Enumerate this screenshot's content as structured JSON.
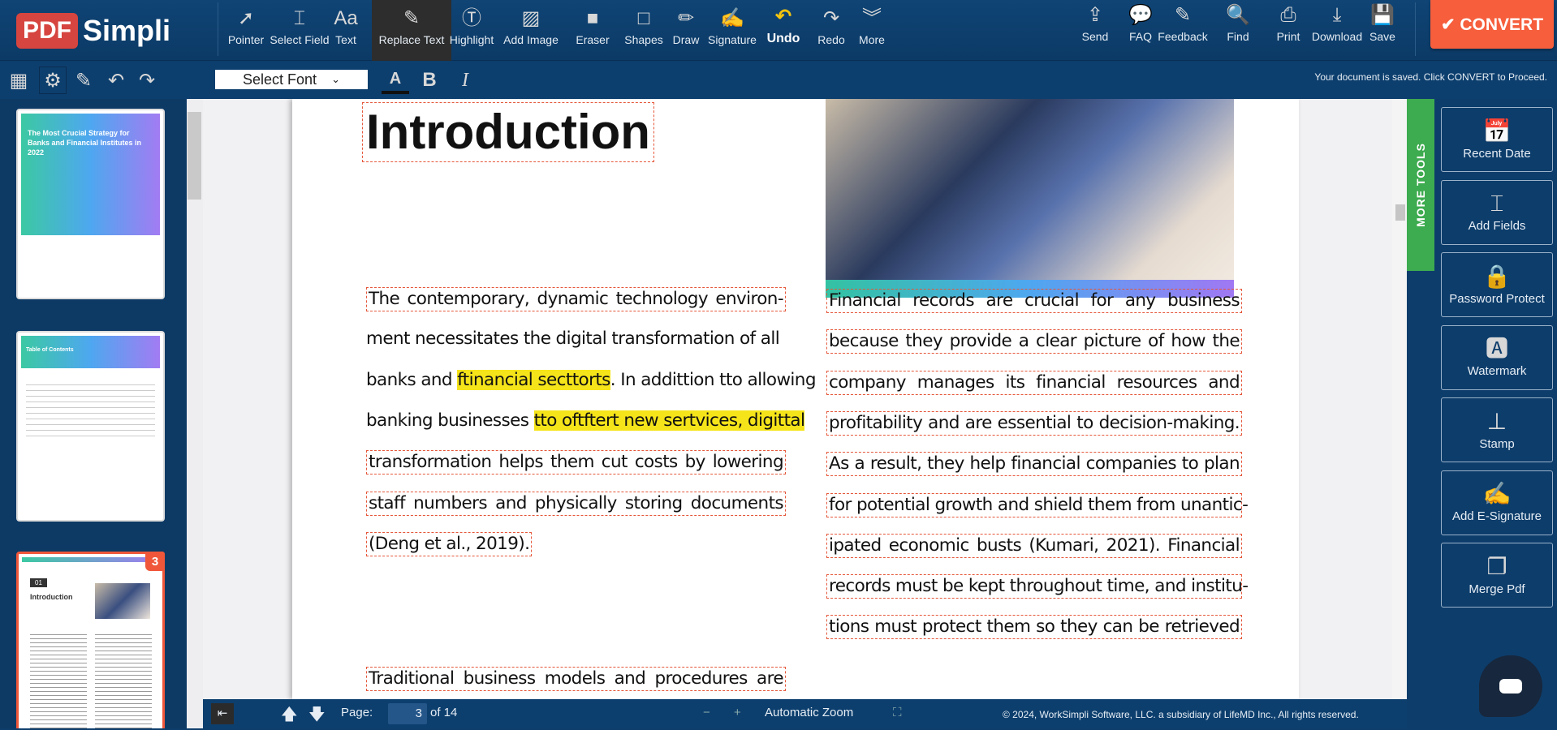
{
  "logo": {
    "pdf": "PDF",
    "simpli": "Simpli"
  },
  "toolbar": {
    "left": [
      {
        "label": "Pointer",
        "icon": "➚"
      },
      {
        "label": "Select Field",
        "icon": "⌶"
      },
      {
        "label": "Text",
        "icon": "Aa"
      },
      {
        "label": "Replace Text",
        "icon": "✎"
      },
      {
        "label": "Highlight",
        "icon": "Ⓣ"
      },
      {
        "label": "Add Image",
        "icon": "▨"
      },
      {
        "label": "Eraser",
        "icon": "■"
      },
      {
        "label": "Shapes",
        "icon": "□"
      },
      {
        "label": "Draw",
        "icon": "✏"
      },
      {
        "label": "Signature",
        "icon": "✍"
      },
      {
        "label": "Undo",
        "icon": "↶"
      },
      {
        "label": "Redo",
        "icon": "↷"
      },
      {
        "label": "More",
        "icon": "︾"
      }
    ],
    "right": [
      {
        "label": "Send",
        "icon": "⇪"
      },
      {
        "label": "FAQ",
        "icon": "💬"
      },
      {
        "label": "Feedback",
        "icon": "✎"
      },
      {
        "label": "Find",
        "icon": "🔍"
      },
      {
        "label": "Print",
        "icon": "⎙"
      },
      {
        "label": "Download",
        "icon": "⤓"
      },
      {
        "label": "Save",
        "icon": "💾"
      }
    ],
    "convert": "✔ CONVERT"
  },
  "format": {
    "font_select": "Select Font",
    "color": "A",
    "bold": "B",
    "italic": "I"
  },
  "status": "Your document is saved. Click CONVERT to Proceed.",
  "thumbnails": {
    "selected_badge": "3",
    "t1_title": "The Most Crucial Strategy for Banks and Financial Institutes in 2022",
    "t2_title": "Table of Contents",
    "t3_num": "01",
    "t3_title": "Introduction"
  },
  "document": {
    "heading": "Introduction",
    "left": [
      {
        "parts": [
          {
            "t": "The contemporary, dynamic technology environ-"
          }
        ]
      },
      {
        "parts": [
          {
            "t": "ment necessitates the digital transformation of all"
          }
        ]
      },
      {
        "parts": [
          {
            "t": "banks and "
          },
          {
            "t": "ftinancial secttorts",
            "hl": true
          },
          {
            "t": ". In addittion tto allowing"
          }
        ]
      },
      {
        "parts": [
          {
            "t": "banking businesses "
          },
          {
            "t": "tto oftftert new sertvices, digittal",
            "hl": true
          }
        ]
      },
      {
        "parts": [
          {
            "t": "transformation helps them cut costs by lowering"
          }
        ]
      },
      {
        "parts": [
          {
            "t": "staff numbers and physically storing documents"
          }
        ]
      },
      {
        "parts": [
          {
            "t": "(Deng et al., 2019)."
          }
        ]
      },
      {
        "parts": [
          {
            "t": "Traditional business models and procedures are"
          }
        ]
      }
    ],
    "right": [
      "Financial records are crucial for any business",
      "because they provide a clear picture of how the",
      "company manages its financial resources and",
      "profitability and are essential to decision-making.",
      "As a result, they help financial companies to plan",
      "for potential growth and shield them from unantic-",
      "ipated economic busts (Kumari, 2021). Financial",
      "records must be kept throughout time, and institu-",
      "tions must protect them so they can be retrieved"
    ]
  },
  "more_tools": "MORE TOOLS",
  "right_panel": [
    {
      "label": "Recent Date",
      "icon": "📅"
    },
    {
      "label": "Add Fields",
      "icon": "⌶"
    },
    {
      "label": "Password Protect",
      "icon": "🔒"
    },
    {
      "label": "Watermark",
      "icon": "🅰"
    },
    {
      "label": "Stamp",
      "icon": "⊥"
    },
    {
      "label": "Add E-Signature",
      "icon": "✍"
    },
    {
      "label": "Merge Pdf",
      "icon": "❐"
    }
  ],
  "footer": {
    "page_label": "Page:",
    "page": "3",
    "of": "of 14",
    "zoom": "Automatic Zoom",
    "copyright": "© 2024, WorkSimpli Software, LLC. a subsidiary of LifeMD Inc., All rights reserved."
  }
}
